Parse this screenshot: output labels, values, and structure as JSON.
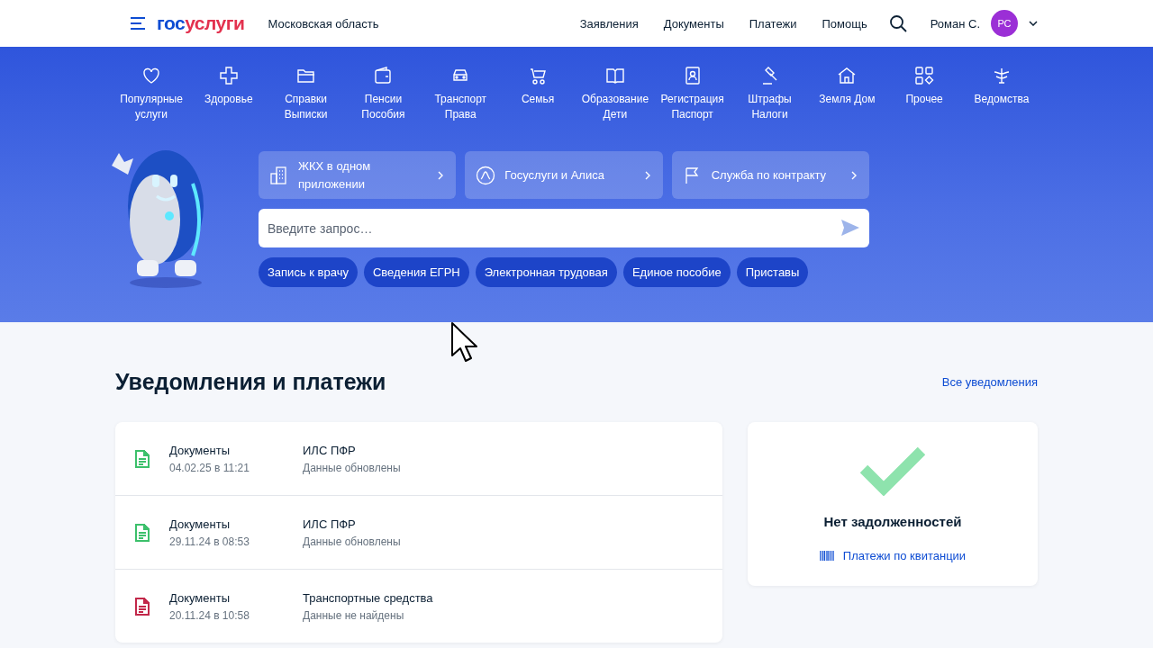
{
  "header": {
    "logo": {
      "first": "гос",
      "second": "услуги"
    },
    "region": "Московская область",
    "nav": [
      "Заявления",
      "Документы",
      "Платежи",
      "Помощь"
    ],
    "user": {
      "name": "Роман С.",
      "initials": "РС"
    }
  },
  "categories": [
    {
      "label": "Популярные",
      "label2": "услуги"
    },
    {
      "label": "Здоровье"
    },
    {
      "label": "Справки",
      "label2": "Выписки"
    },
    {
      "label": "Пенсии",
      "label2": "Пособия"
    },
    {
      "label": "Транспорт",
      "label2": "Права"
    },
    {
      "label": "Семья"
    },
    {
      "label": "Образование",
      "label2": "Дети"
    },
    {
      "label": "Регистрация",
      "label2": "Паспорт"
    },
    {
      "label": "Штрафы",
      "label2": "Налоги"
    },
    {
      "label": "Земля Дом"
    },
    {
      "label": "Прочее"
    },
    {
      "label": "Ведомства"
    }
  ],
  "promos": [
    {
      "label": "ЖКХ в одном приложении"
    },
    {
      "label": "Госуслуги и Алиса"
    },
    {
      "label": "Служба по контракту"
    }
  ],
  "search": {
    "placeholder": "Введите запрос…"
  },
  "quick_links": [
    "Запись к врачу",
    "Сведения ЕГРН",
    "Электронная трудовая",
    "Единое пособие",
    "Приставы"
  ],
  "notifications": {
    "title": "Уведомления и платежи",
    "all_link": "Все уведомления",
    "items": [
      {
        "category": "Документы",
        "date": "04.02.25 в 11:21",
        "title": "ИЛС ПФР",
        "status": "Данные обновлены",
        "color": "#3cc06b"
      },
      {
        "category": "Документы",
        "date": "29.11.24 в 08:53",
        "title": "ИЛС ПФР",
        "status": "Данные обновлены",
        "color": "#3cc06b"
      },
      {
        "category": "Документы",
        "date": "20.11.24 в 10:58",
        "title": "Транспортные средства",
        "status": "Данные не найдены",
        "color": "#c2284a"
      }
    ]
  },
  "debts": {
    "title": "Нет задолженностей",
    "link": "Платежи по квитанции"
  }
}
